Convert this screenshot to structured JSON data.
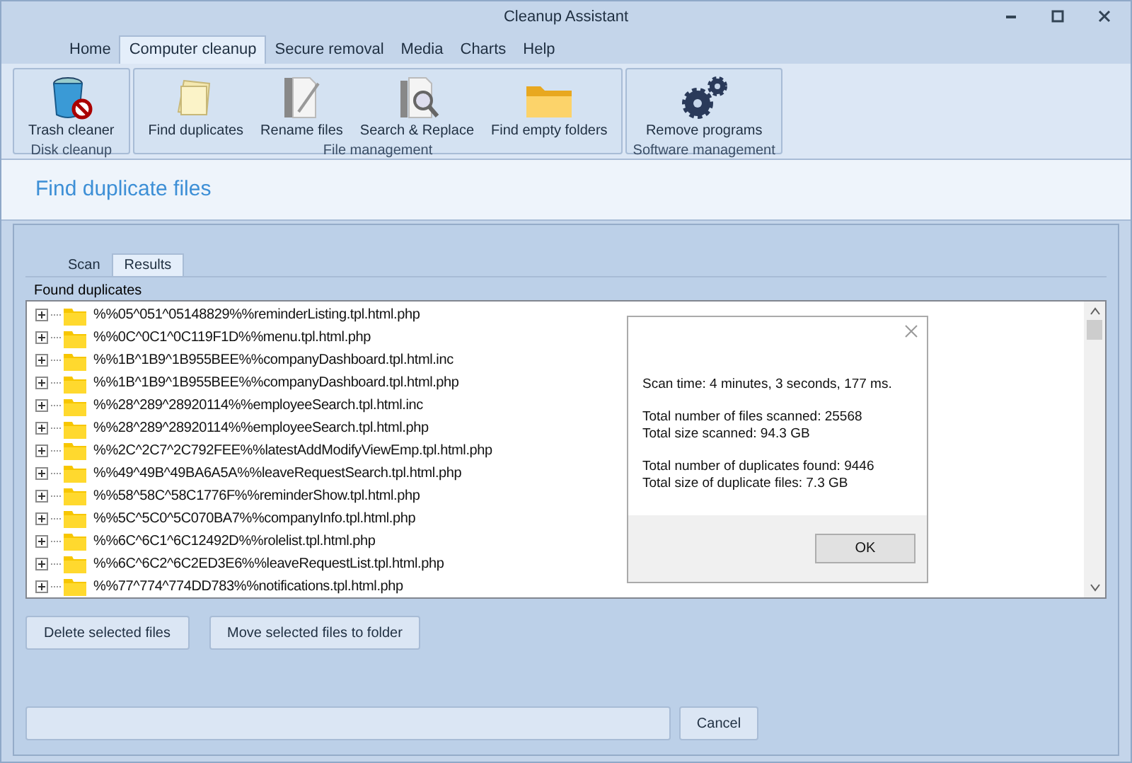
{
  "window": {
    "title": "Cleanup Assistant"
  },
  "menu_tabs": [
    {
      "label": "Home",
      "selected": false
    },
    {
      "label": "Computer cleanup",
      "selected": true
    },
    {
      "label": "Secure removal",
      "selected": false
    },
    {
      "label": "Media",
      "selected": false
    },
    {
      "label": "Charts",
      "selected": false
    },
    {
      "label": "Help",
      "selected": false
    }
  ],
  "ribbon_groups": [
    {
      "label": "Disk cleanup",
      "buttons": [
        {
          "label": "Trash cleaner",
          "kind": "trash"
        }
      ]
    },
    {
      "label": "File management",
      "buttons": [
        {
          "label": "Find duplicates",
          "kind": "papers"
        },
        {
          "label": "Rename files",
          "kind": "rename"
        },
        {
          "label": "Search & Replace",
          "kind": "search"
        },
        {
          "label": "Find empty folders",
          "kind": "folder"
        }
      ]
    },
    {
      "label": "Software management",
      "buttons": [
        {
          "label": "Remove programs",
          "kind": "gears"
        }
      ]
    }
  ],
  "page_title": "Find duplicate files",
  "sub_tabs": [
    {
      "label": "Scan",
      "selected": false
    },
    {
      "label": "Results",
      "selected": true
    }
  ],
  "group_label": "Found duplicates",
  "tree_items": [
    {
      "label": "%%05^051^05148829%%reminderListing.tpl.html.php",
      "expanded": false
    },
    {
      "label": "%%0C^0C1^0C119F1D%%menu.tpl.html.php",
      "expanded": false
    },
    {
      "label": "%%1B^1B9^1B955BEE%%companyDashboard.tpl.html.inc",
      "expanded": false
    },
    {
      "label": "%%1B^1B9^1B955BEE%%companyDashboard.tpl.html.php",
      "expanded": false
    },
    {
      "label": "%%28^289^28920114%%employeeSearch.tpl.html.inc",
      "expanded": false
    },
    {
      "label": "%%28^289^28920114%%employeeSearch.tpl.html.php",
      "expanded": false
    },
    {
      "label": "%%2C^2C7^2C792FEE%%latestAddModifyViewEmp.tpl.html.php",
      "expanded": false
    },
    {
      "label": "%%49^49B^49BA6A5A%%leaveRequestSearch.tpl.html.php",
      "expanded": false
    },
    {
      "label": "%%58^58C^58C1776F%%reminderShow.tpl.html.php",
      "expanded": false
    },
    {
      "label": "%%5C^5C0^5C070BA7%%companyInfo.tpl.html.php",
      "expanded": false
    },
    {
      "label": "%%6C^6C1^6C12492D%%rolelist.tpl.html.php",
      "expanded": false
    },
    {
      "label": "%%6C^6C2^6C2ED3E6%%leaveRequestList.tpl.html.php",
      "expanded": false
    },
    {
      "label": "%%77^774^774DD783%%notifications.tpl.html.php",
      "expanded": false
    }
  ],
  "actions": [
    "Delete selected files",
    "Move selected files to folder"
  ],
  "progress": {
    "level": 0
  },
  "cancel": "Cancel",
  "dialog": {
    "paragraphs": [
      [
        "Scan time: 4 minutes, 3 seconds, 177 ms."
      ],
      [
        "Total number of files scanned: 25568",
        "Total size scanned: 94.3 GB"
      ],
      [
        "Total number of duplicates found: 9446",
        "Total size of duplicate files: 7.3 GB"
      ]
    ],
    "ok": "OK"
  }
}
